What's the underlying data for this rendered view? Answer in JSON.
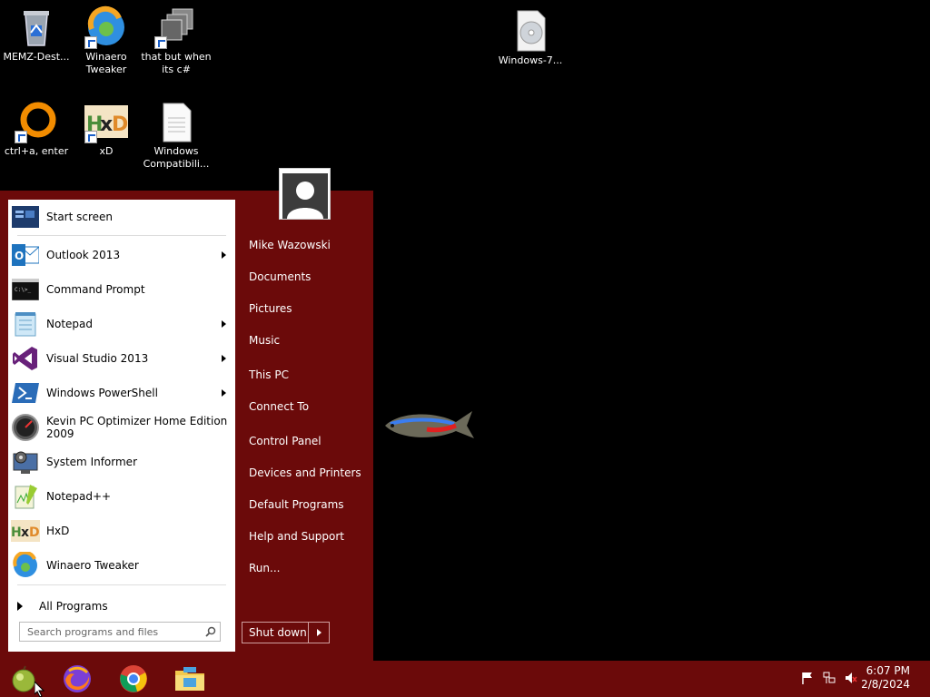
{
  "desktop": {
    "icons": [
      {
        "label": "MEMZ-Dest...",
        "icon": "recycle-bin-icon"
      },
      {
        "label": "Winaero Tweaker",
        "icon": "winaero-icon"
      },
      {
        "label": "that but when its c#",
        "icon": "windows-stack-icon"
      },
      {
        "label": "Windows-7...",
        "icon": "disc-image-icon"
      },
      {
        "label": "ctrl+a, enter",
        "icon": "orange-ring-icon"
      },
      {
        "label": "xD",
        "icon": "hxd-icon"
      },
      {
        "label": "Windows Compatibili...",
        "icon": "document-icon"
      }
    ]
  },
  "start_menu": {
    "programs": [
      {
        "label": "Start screen",
        "icon": "start-screen-icon",
        "submenu": false
      },
      {
        "label": "Outlook 2013",
        "icon": "outlook-icon",
        "submenu": true
      },
      {
        "label": "Command Prompt",
        "icon": "cmd-icon",
        "submenu": false
      },
      {
        "label": "Notepad",
        "icon": "notepad-icon",
        "submenu": true
      },
      {
        "label": "Visual Studio 2013",
        "icon": "visual-studio-icon",
        "submenu": true
      },
      {
        "label": "Windows PowerShell",
        "icon": "powershell-icon",
        "submenu": true
      },
      {
        "label": "Kevin PC Optimizer Home Edition 2009",
        "icon": "gauge-icon",
        "submenu": false
      },
      {
        "label": "System Informer",
        "icon": "system-informer-icon",
        "submenu": false
      },
      {
        "label": "Notepad++",
        "icon": "notepadpp-icon",
        "submenu": false
      },
      {
        "label": "HxD",
        "icon": "hxd-icon",
        "submenu": false
      },
      {
        "label": "Winaero Tweaker",
        "icon": "winaero-icon",
        "submenu": false
      }
    ],
    "all_programs": "All Programs",
    "search_placeholder": "Search programs and files",
    "user_name": "Mike Wazowski",
    "places": [
      "Documents",
      "Pictures",
      "Music",
      "This PC",
      "Connect To",
      "Control Panel",
      "Devices and Printers",
      "Default Programs",
      "Help and Support",
      "Run..."
    ],
    "shutdown": "Shut down"
  },
  "taskbar": {
    "pinned": [
      "start-orb-icon",
      "firefox-icon",
      "chrome-icon",
      "file-explorer-icon"
    ],
    "time": "6:07 PM",
    "date": "2/8/2024"
  }
}
